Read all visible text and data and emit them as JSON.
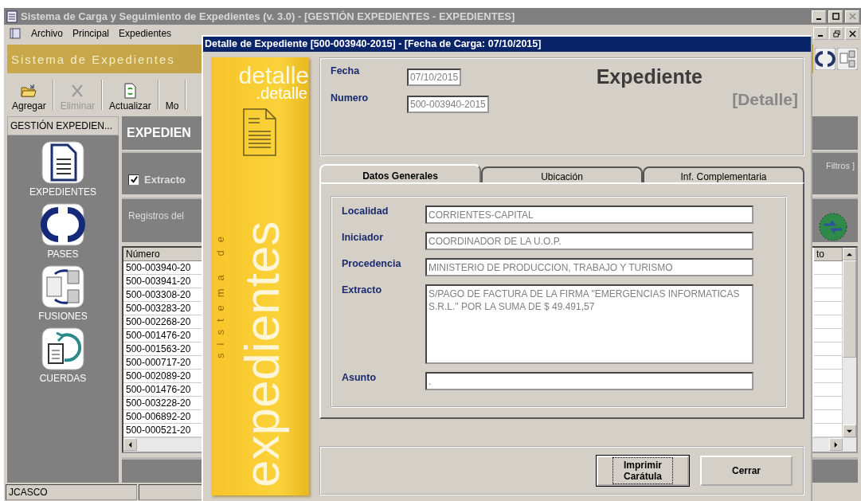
{
  "window": {
    "title": "Sistema de Carga y Seguimiento de Expedientes (v. 3.0) - [GESTIÓN EXPEDIENTES - EXPEDIENTES]"
  },
  "menu": [
    "Archivo",
    "Principal",
    "Expedientes"
  ],
  "banner": {
    "title": "Sistema de Expedientes"
  },
  "toolbar": [
    {
      "label": "Agregar",
      "kind": "open",
      "disabled": false
    },
    {
      "label": "Eliminar",
      "kind": "delete",
      "disabled": true
    },
    {
      "label": "Actualizar",
      "kind": "refresh",
      "disabled": false
    },
    {
      "label": "Mo",
      "kind": "hidden",
      "disabled": false
    }
  ],
  "sidebar": {
    "header": "GESTIÓN EXPEDIEN...",
    "items": [
      {
        "label": "EXPEDIENTES",
        "kind": "document"
      },
      {
        "label": "PASES",
        "kind": "cycle"
      },
      {
        "label": "FUSIONES",
        "kind": "merge"
      },
      {
        "label": "CUERDAS",
        "kind": "string"
      }
    ]
  },
  "main": {
    "header": "EXPEDIEN",
    "filter": {
      "label": "Extracto",
      "checked": true
    },
    "filters_link": "Filtros ]",
    "records_label": "Registros del"
  },
  "table": {
    "columns": [
      "Número",
      "to"
    ],
    "rows": [
      "500-003940-20",
      "500-003941-20",
      "500-003308-20",
      "500-003283-20",
      "500-002268-20",
      "500-001476-20",
      "500-001563-20",
      "500-000717-20",
      "500-002089-20",
      "500-001476-20",
      "500-003228-20",
      "500-006892-20",
      "500-000521-20"
    ]
  },
  "status_bar": [
    "JCASCO"
  ],
  "dialog": {
    "title": "Detalle de Expediente [500-003940-2015] - [Fecha de Carga: 07/10/2015]",
    "side": {
      "ghost": "detalle",
      "label": ".detalle",
      "vertical_small": "sistema de",
      "vertical_large": "expedientes"
    },
    "heading": "Expediente",
    "subheading": "[Detalle]",
    "top_fields": [
      {
        "label": "Fecha",
        "value": "07/10/2015"
      },
      {
        "label": "Numero",
        "value": "500-003940-2015"
      }
    ],
    "tabs": [
      {
        "label": "Datos Generales",
        "selected": true
      },
      {
        "label": "Ubicación",
        "selected": false
      },
      {
        "label": "Inf. Complementaria",
        "selected": false
      }
    ],
    "fields": [
      {
        "label": "Localidad",
        "value": "CORRIENTES-CAPITAL",
        "kind": "line"
      },
      {
        "label": "Iniciador",
        "value": "COORDINADOR DE LA U.O.P.",
        "kind": "line"
      },
      {
        "label": "Procedencia",
        "value": "MINISTERIO DE PRODUCCION, TRABAJO Y TURISMO",
        "kind": "line"
      },
      {
        "label": "Extracto",
        "value": "S/PAGO DE FACTURA DE LA FIRMA \"EMERGENCIAS INFORMATICAS S.R.L.\" POR LA SUMA DE $ 49.491,57",
        "kind": "multiline"
      },
      {
        "label": "Asunto",
        "value": ".",
        "kind": "line"
      }
    ],
    "buttons": [
      {
        "label": "Imprimir Carátula",
        "focused": true
      },
      {
        "label": "Cerrar",
        "focused": false
      }
    ]
  }
}
